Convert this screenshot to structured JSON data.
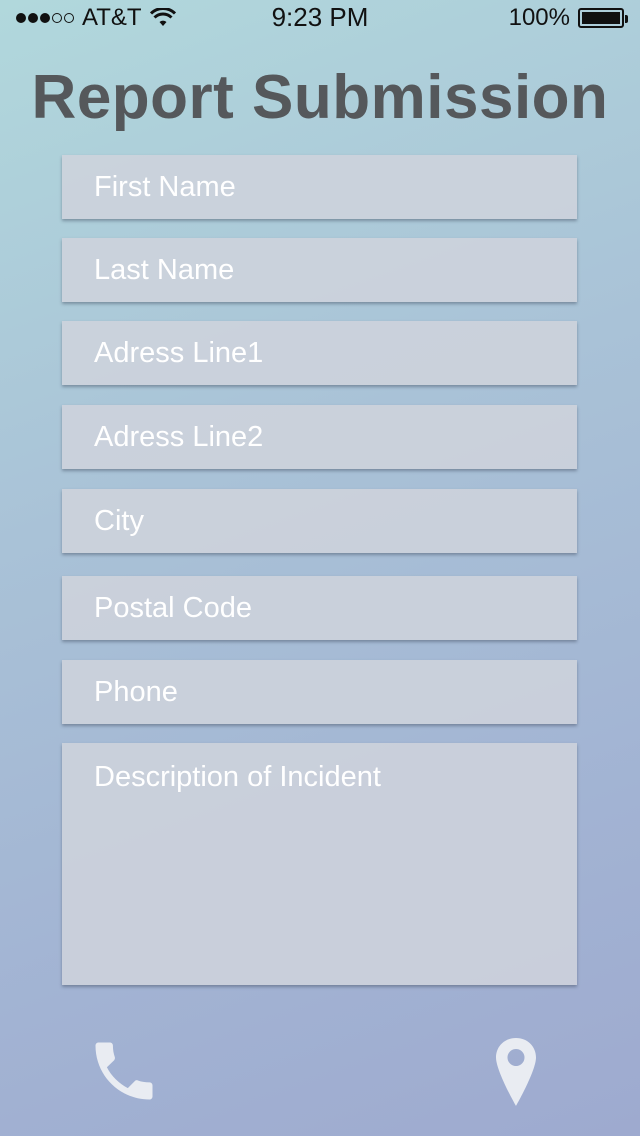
{
  "status_bar": {
    "carrier": "AT&T",
    "time": "9:23 PM",
    "battery_percent": "100%",
    "signal_bars_filled": 3,
    "signal_bars_total": 5
  },
  "title": "Report Submission",
  "form": {
    "fields": [
      {
        "name": "first-name-field",
        "placeholder": "First Name"
      },
      {
        "name": "last-name-field",
        "placeholder": "Last Name"
      },
      {
        "name": "address-line1-field",
        "placeholder": "Adress Line1"
      },
      {
        "name": "address-line2-field",
        "placeholder": "Adress Line2"
      },
      {
        "name": "city-field",
        "placeholder": "City"
      },
      {
        "name": "postal-code-field",
        "placeholder": "Postal Code"
      },
      {
        "name": "phone-field",
        "placeholder": "Phone"
      },
      {
        "name": "description-field",
        "placeholder": "Description of Incident"
      }
    ]
  },
  "bottom_bar": {
    "left_icon": "phone-icon",
    "right_icon": "location-pin-icon",
    "icon_color": "#e9ecf2"
  }
}
